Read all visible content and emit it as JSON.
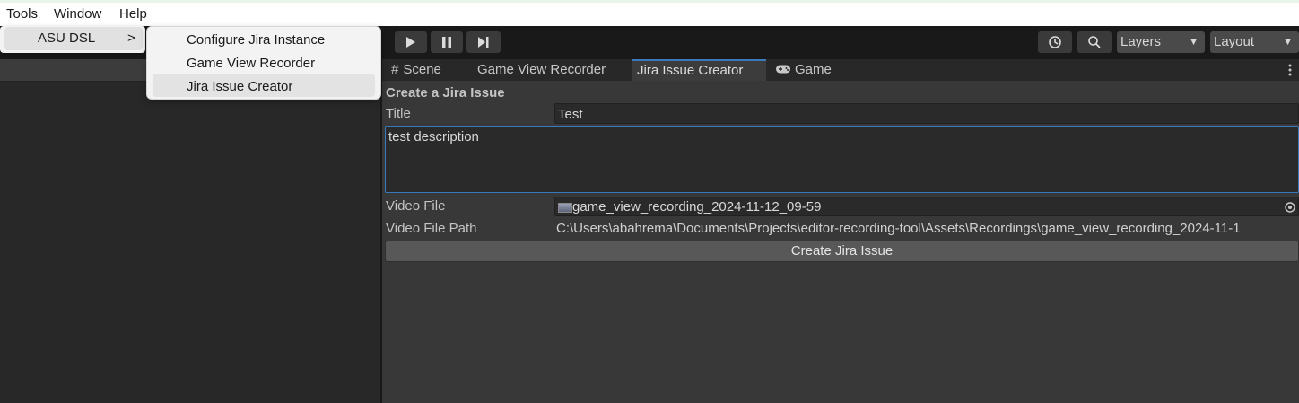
{
  "menubar": {
    "items": [
      "Tools",
      "Window",
      "Help"
    ]
  },
  "tools_menu": {
    "item": "ASU DSL",
    "chevron": ">"
  },
  "submenu": {
    "items": [
      "Configure Jira Instance",
      "Game View Recorder",
      "Jira Issue Creator"
    ],
    "highlighted": "Jira Issue Creator"
  },
  "toolbar": {
    "play": "play-icon",
    "pause": "pause-icon",
    "step": "step-icon",
    "history": "history-icon",
    "search": "search-icon",
    "layers_label": "Layers",
    "layout_label": "Layout"
  },
  "tabs": [
    {
      "icon": "#",
      "label": "Scene"
    },
    {
      "icon": "",
      "label": "Game View Recorder"
    },
    {
      "icon": "",
      "label": "Jira Issue Creator",
      "active": true
    },
    {
      "icon": "gamepad-icon",
      "label": "Game"
    }
  ],
  "form": {
    "heading": "Create a Jira Issue",
    "title_label": "Title",
    "title_value": "Test",
    "description_value": "test description",
    "video_file_label": "Video File",
    "video_file_value": "game_view_recording_2024-11-12_09-59",
    "video_path_label": "Video File Path",
    "video_path_value": "C:\\Users\\abahrema\\Documents\\Projects\\editor-recording-tool\\Assets\\Recordings\\game_view_recording_2024-11-1",
    "submit_label": "Create Jira Issue"
  },
  "colors": {
    "accent": "#3a79bb",
    "panel": "#383838",
    "toolbar": "#191919"
  }
}
